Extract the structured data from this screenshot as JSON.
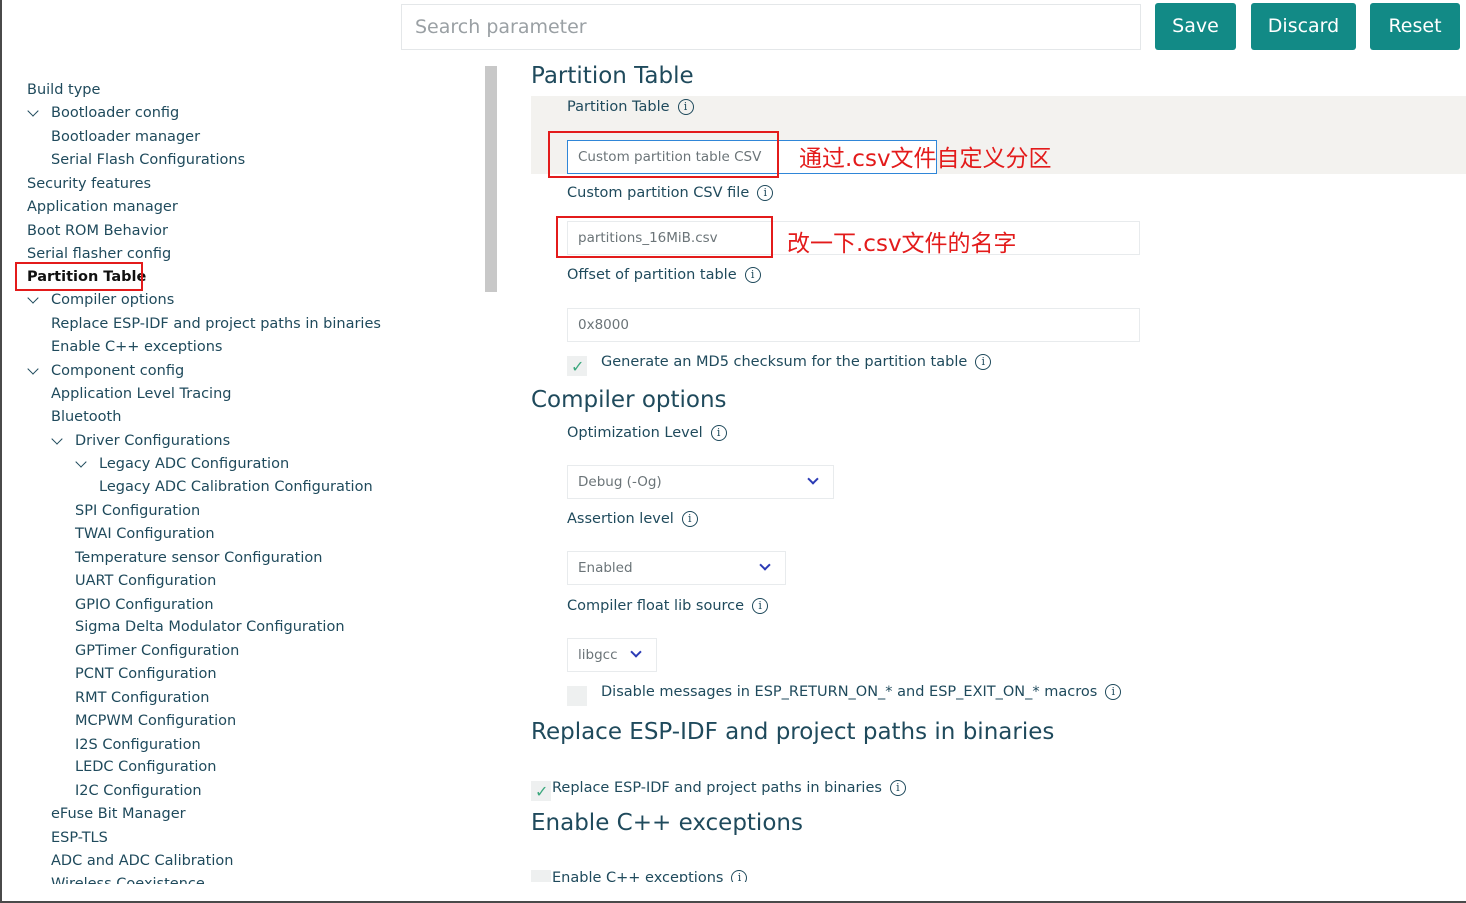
{
  "toolbar": {
    "search_placeholder": "Search parameter",
    "save_label": "Save",
    "discard_label": "Discard",
    "reset_label": "Reset"
  },
  "sidebar": {
    "items": [
      {
        "label": "Build type"
      },
      {
        "label": "Bootloader config"
      },
      {
        "label": "Bootloader manager"
      },
      {
        "label": "Serial Flash Configurations"
      },
      {
        "label": "Security features"
      },
      {
        "label": "Application manager"
      },
      {
        "label": "Boot ROM Behavior"
      },
      {
        "label": "Serial flasher config"
      },
      {
        "label": "Partition Table"
      },
      {
        "label": "Compiler options"
      },
      {
        "label": "Replace ESP-IDF and project paths in binaries"
      },
      {
        "label": "Enable C++ exceptions"
      },
      {
        "label": "Component config"
      },
      {
        "label": "Application Level Tracing"
      },
      {
        "label": "Bluetooth"
      },
      {
        "label": "Driver Configurations"
      },
      {
        "label": "Legacy ADC Configuration"
      },
      {
        "label": "Legacy ADC Calibration Configuration"
      },
      {
        "label": "SPI Configuration"
      },
      {
        "label": "TWAI Configuration"
      },
      {
        "label": "Temperature sensor Configuration"
      },
      {
        "label": "UART Configuration"
      },
      {
        "label": "GPIO Configuration"
      },
      {
        "label": "Sigma Delta Modulator Configuration"
      },
      {
        "label": "GPTimer Configuration"
      },
      {
        "label": "PCNT Configuration"
      },
      {
        "label": "RMT Configuration"
      },
      {
        "label": "MCPWM Configuration"
      },
      {
        "label": "I2S Configuration"
      },
      {
        "label": "LEDC Configuration"
      },
      {
        "label": "I2C Configuration"
      },
      {
        "label": "eFuse Bit Manager"
      },
      {
        "label": "ESP-TLS"
      },
      {
        "label": "ADC and ADC Calibration"
      },
      {
        "label": "Wireless Coexistence"
      }
    ]
  },
  "main": {
    "partition": {
      "heading": "Partition Table",
      "table_label": "Partition Table",
      "table_value": "Custom partition table CSV",
      "csv_label": "Custom partition CSV file",
      "csv_value": "partitions_16MiB.csv",
      "offset_label": "Offset of partition table",
      "offset_value": "0x8000",
      "md5_label": "Generate an MD5 checksum for the partition table",
      "md5_checked": true
    },
    "compiler": {
      "heading": "Compiler options",
      "opt_label": "Optimization Level",
      "opt_value": "Debug (-Og)",
      "assert_label": "Assertion level",
      "assert_value": "Enabled",
      "float_label": "Compiler float lib source",
      "float_value": "libgcc",
      "disable_msgs_label": "Disable messages in ESP_RETURN_ON_* and ESP_EXIT_ON_* macros",
      "disable_msgs_checked": false
    },
    "replace_paths": {
      "heading": "Replace ESP-IDF and project paths in binaries",
      "label": "Replace ESP-IDF and project paths in binaries",
      "checked": true
    },
    "cpp": {
      "heading": "Enable C++ exceptions",
      "label": "Enable C++ exceptions",
      "checked": false
    }
  },
  "annotations": {
    "note1": "通过.csv文件自定义分区",
    "note2": "改一下.csv文件的名字",
    "color": "#e31b1b"
  },
  "colors": {
    "accent": "#128a86",
    "text": "#1f4a5c",
    "check": "#3ca87e"
  },
  "icons": {
    "info": "info-icon",
    "chevron": "chevron-down-icon",
    "check": "check-icon"
  }
}
